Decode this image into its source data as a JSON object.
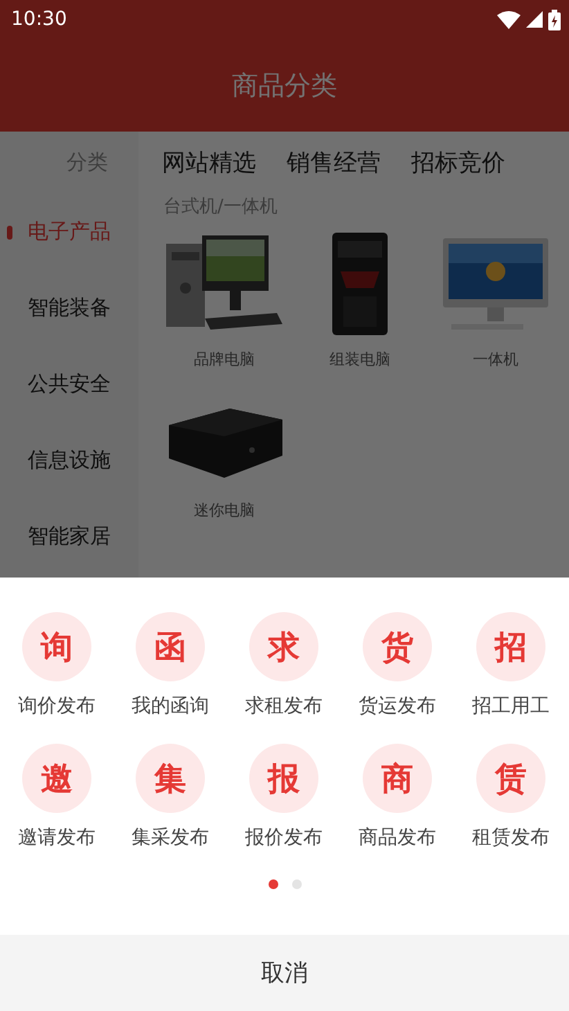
{
  "status_bar": {
    "time": "10:30"
  },
  "header": {
    "title": "商品分类"
  },
  "sidebar": {
    "heading": "分类",
    "items": [
      {
        "label": "电子产品",
        "selected": true
      },
      {
        "label": "智能装备",
        "selected": false
      },
      {
        "label": "公共安全",
        "selected": false
      },
      {
        "label": "信息设施",
        "selected": false
      },
      {
        "label": "智能家居",
        "selected": false
      }
    ]
  },
  "tabs": [
    {
      "label": "网站精选"
    },
    {
      "label": "销售经营"
    },
    {
      "label": "招标竞价"
    }
  ],
  "section": {
    "title": "台式机/一体机",
    "products": [
      {
        "label": "品牌电脑"
      },
      {
        "label": "组装电脑"
      },
      {
        "label": "一体机"
      },
      {
        "label": "迷你电脑"
      }
    ]
  },
  "sheet": {
    "actions": [
      {
        "glyph": "询",
        "label": "询价发布"
      },
      {
        "glyph": "函",
        "label": "我的函询"
      },
      {
        "glyph": "求",
        "label": "求租发布"
      },
      {
        "glyph": "货",
        "label": "货运发布"
      },
      {
        "glyph": "招",
        "label": "招工用工"
      },
      {
        "glyph": "邀",
        "label": "邀请发布"
      },
      {
        "glyph": "集",
        "label": "集采发布"
      },
      {
        "glyph": "报",
        "label": "报价发布"
      },
      {
        "glyph": "商",
        "label": "商品发布"
      },
      {
        "glyph": "赁",
        "label": "租赁发布"
      }
    ],
    "pages": [
      {
        "selected": true
      },
      {
        "selected": false
      }
    ],
    "cancel": "取消"
  }
}
